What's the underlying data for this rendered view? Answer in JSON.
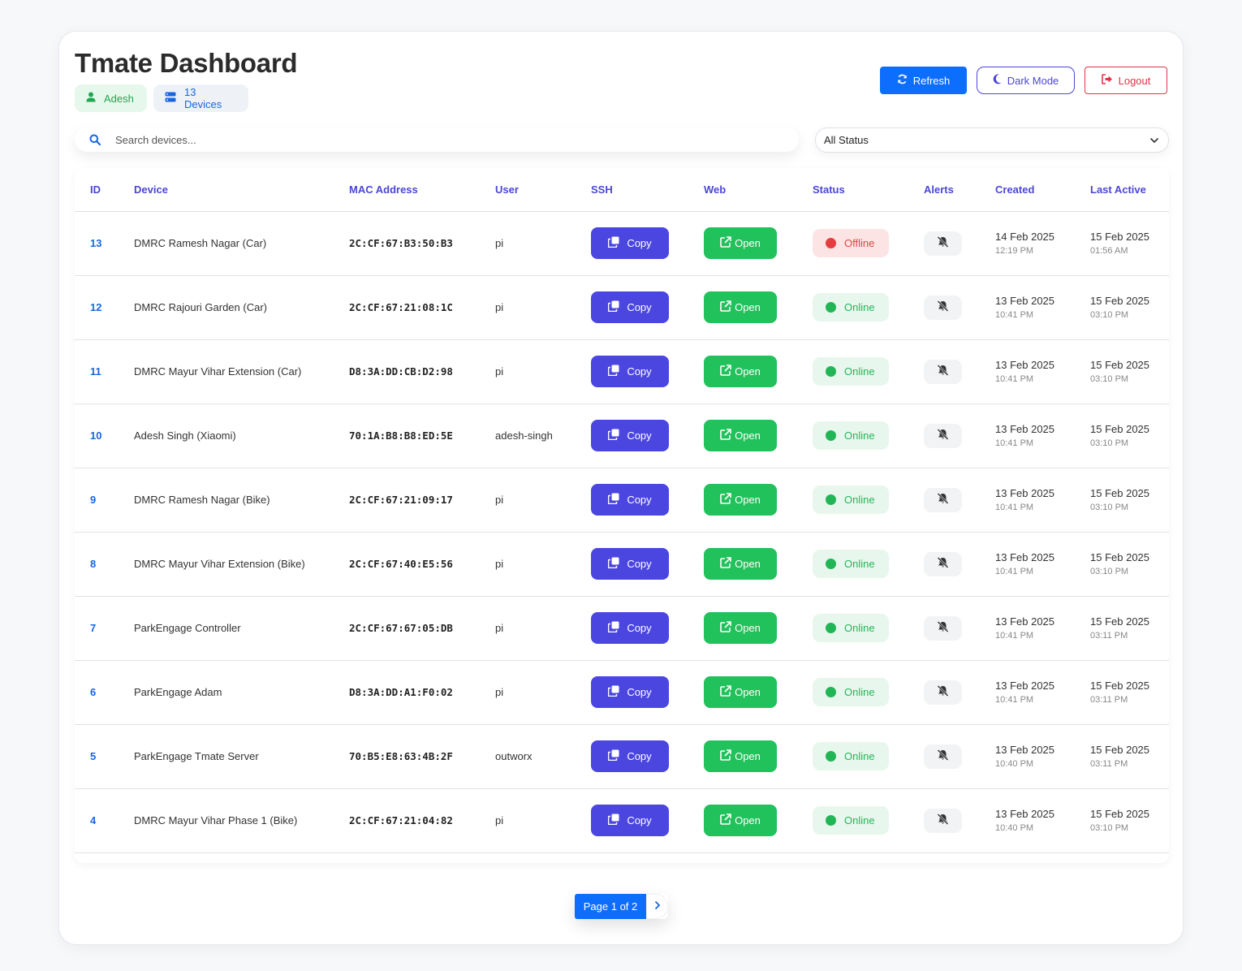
{
  "header": {
    "title": "Tmate Dashboard",
    "user_chip": "Adesh",
    "devices_chip": "13 Devices",
    "refresh_label": "Refresh",
    "dark_mode_label": "Dark Mode",
    "logout_label": "Logout"
  },
  "search": {
    "placeholder": "Search devices..."
  },
  "filter": {
    "selected": "All Status"
  },
  "table": {
    "columns": [
      "ID",
      "Device",
      "MAC Address",
      "User",
      "SSH",
      "Web",
      "Status",
      "Alerts",
      "Created",
      "Last Active"
    ],
    "rows": [
      {
        "id": "13",
        "device": "DMRC Ramesh Nagar (Car)",
        "mac": "2C:CF:67:B3:50:B3",
        "user": "pi",
        "ssh": "Copy",
        "web": "Open",
        "status": "Offline",
        "status_key": "offline",
        "created_date": "14 Feb 2025",
        "created_time": "12:19 PM",
        "last_date": "15 Feb 2025",
        "last_time": "01:56 AM"
      },
      {
        "id": "12",
        "device": "DMRC Rajouri Garden (Car)",
        "mac": "2C:CF:67:21:08:1C",
        "user": "pi",
        "ssh": "Copy",
        "web": "Open",
        "status": "Online",
        "status_key": "online",
        "created_date": "13 Feb 2025",
        "created_time": "10:41 PM",
        "last_date": "15 Feb 2025",
        "last_time": "03:10 PM"
      },
      {
        "id": "11",
        "device": "DMRC Mayur Vihar Extension (Car)",
        "mac": "D8:3A:DD:CB:D2:98",
        "user": "pi",
        "ssh": "Copy",
        "web": "Open",
        "status": "Online",
        "status_key": "online",
        "created_date": "13 Feb 2025",
        "created_time": "10:41 PM",
        "last_date": "15 Feb 2025",
        "last_time": "03:10 PM"
      },
      {
        "id": "10",
        "device": "Adesh Singh (Xiaomi)",
        "mac": "70:1A:B8:B8:ED:5E",
        "user": "adesh-singh",
        "ssh": "Copy",
        "web": "Open",
        "status": "Online",
        "status_key": "online",
        "created_date": "13 Feb 2025",
        "created_time": "10:41 PM",
        "last_date": "15 Feb 2025",
        "last_time": "03:10 PM"
      },
      {
        "id": "9",
        "device": "DMRC Ramesh Nagar (Bike)",
        "mac": "2C:CF:67:21:09:17",
        "user": "pi",
        "ssh": "Copy",
        "web": "Open",
        "status": "Online",
        "status_key": "online",
        "created_date": "13 Feb 2025",
        "created_time": "10:41 PM",
        "last_date": "15 Feb 2025",
        "last_time": "03:10 PM"
      },
      {
        "id": "8",
        "device": "DMRC Mayur Vihar Extension (Bike)",
        "mac": "2C:CF:67:40:E5:56",
        "user": "pi",
        "ssh": "Copy",
        "web": "Open",
        "status": "Online",
        "status_key": "online",
        "created_date": "13 Feb 2025",
        "created_time": "10:41 PM",
        "last_date": "15 Feb 2025",
        "last_time": "03:10 PM"
      },
      {
        "id": "7",
        "device": "ParkEngage Controller",
        "mac": "2C:CF:67:67:05:DB",
        "user": "pi",
        "ssh": "Copy",
        "web": "Open",
        "status": "Online",
        "status_key": "online",
        "created_date": "13 Feb 2025",
        "created_time": "10:41 PM",
        "last_date": "15 Feb 2025",
        "last_time": "03:11 PM"
      },
      {
        "id": "6",
        "device": "ParkEngage Adam",
        "mac": "D8:3A:DD:A1:F0:02",
        "user": "pi",
        "ssh": "Copy",
        "web": "Open",
        "status": "Online",
        "status_key": "online",
        "created_date": "13 Feb 2025",
        "created_time": "10:41 PM",
        "last_date": "15 Feb 2025",
        "last_time": "03:11 PM"
      },
      {
        "id": "5",
        "device": "ParkEngage Tmate Server",
        "mac": "70:B5:E8:63:4B:2F",
        "user": "outworx",
        "ssh": "Copy",
        "web": "Open",
        "status": "Online",
        "status_key": "online",
        "created_date": "13 Feb 2025",
        "created_time": "10:40 PM",
        "last_date": "15 Feb 2025",
        "last_time": "03:11 PM"
      },
      {
        "id": "4",
        "device": "DMRC Mayur Vihar Phase 1 (Bike)",
        "mac": "2C:CF:67:21:04:82",
        "user": "pi",
        "ssh": "Copy",
        "web": "Open",
        "status": "Online",
        "status_key": "online",
        "created_date": "13 Feb 2025",
        "created_time": "10:40 PM",
        "last_date": "15 Feb 2025",
        "last_time": "03:10 PM"
      }
    ]
  },
  "pagination": {
    "label": "Page 1 of 2"
  },
  "colors": {
    "primary": "#0d6efd",
    "indigo": "#4b46e0",
    "green": "#21c15b",
    "danger": "#dc3545"
  },
  "icons": [
    "user-icon",
    "server-icon",
    "refresh-icon",
    "moon-icon",
    "logout-icon",
    "search-icon",
    "chevron-down-icon",
    "copy-icon",
    "external-link-icon",
    "bell-slash-icon",
    "chevron-right-icon"
  ]
}
